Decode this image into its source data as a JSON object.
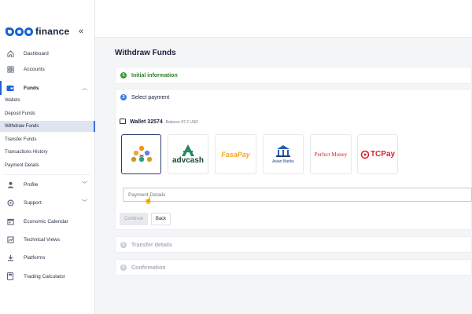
{
  "brand": {
    "name": "finance"
  },
  "sidebar": {
    "collapse_glyph": "«",
    "items": [
      {
        "label": "Dashboard",
        "icon": "home-icon"
      },
      {
        "label": "Accounts",
        "icon": "grid-icon"
      },
      {
        "label": "Funds",
        "icon": "wallet-icon"
      },
      {
        "label": "Profile",
        "icon": "user-icon"
      },
      {
        "label": "Support",
        "icon": "support-icon"
      },
      {
        "label": "Economic Calendar",
        "icon": "calendar-icon"
      },
      {
        "label": "Technical Views",
        "icon": "chart-icon"
      },
      {
        "label": "Platforms",
        "icon": "download-icon"
      },
      {
        "label": "Trading Calculator",
        "icon": "calculator-icon"
      }
    ],
    "funds_sub": [
      {
        "label": "Wallets"
      },
      {
        "label": "Deposit Funds"
      },
      {
        "label": "Withdraw Funds"
      },
      {
        "label": "Transfer Funds"
      },
      {
        "label": "Transactions History"
      },
      {
        "label": "Payment Details"
      }
    ]
  },
  "main": {
    "title": "Withdraw Funds",
    "steps": [
      {
        "num": "1",
        "label": "Initial information",
        "state": "done"
      },
      {
        "num": "2",
        "label": "Select payment",
        "state": "active"
      },
      {
        "num": "3",
        "label": "Transfer details",
        "state": "pending"
      },
      {
        "num": "4",
        "label": "Confirmation",
        "state": "pending"
      }
    ],
    "wallet": {
      "name": "Wallet 32574",
      "balance": "Balance 97.2 USD"
    },
    "methods": [
      {
        "name": "crypto"
      },
      {
        "name": "advcash",
        "label": "advcash"
      },
      {
        "name": "fasapay",
        "label": "FasaPay"
      },
      {
        "name": "asian-banks",
        "label": "Asian Banks"
      },
      {
        "name": "perfect-money",
        "label": "Perfect Money"
      },
      {
        "name": "tcpay",
        "label": "TCPay"
      }
    ],
    "payment_details_placeholder": "Payment Details",
    "continue_label": "Continue",
    "back_label": "Back"
  },
  "colors": {
    "accent": "#1f62d6",
    "done_green": "#3f9a3c",
    "step_blue": "#3d7be0"
  }
}
